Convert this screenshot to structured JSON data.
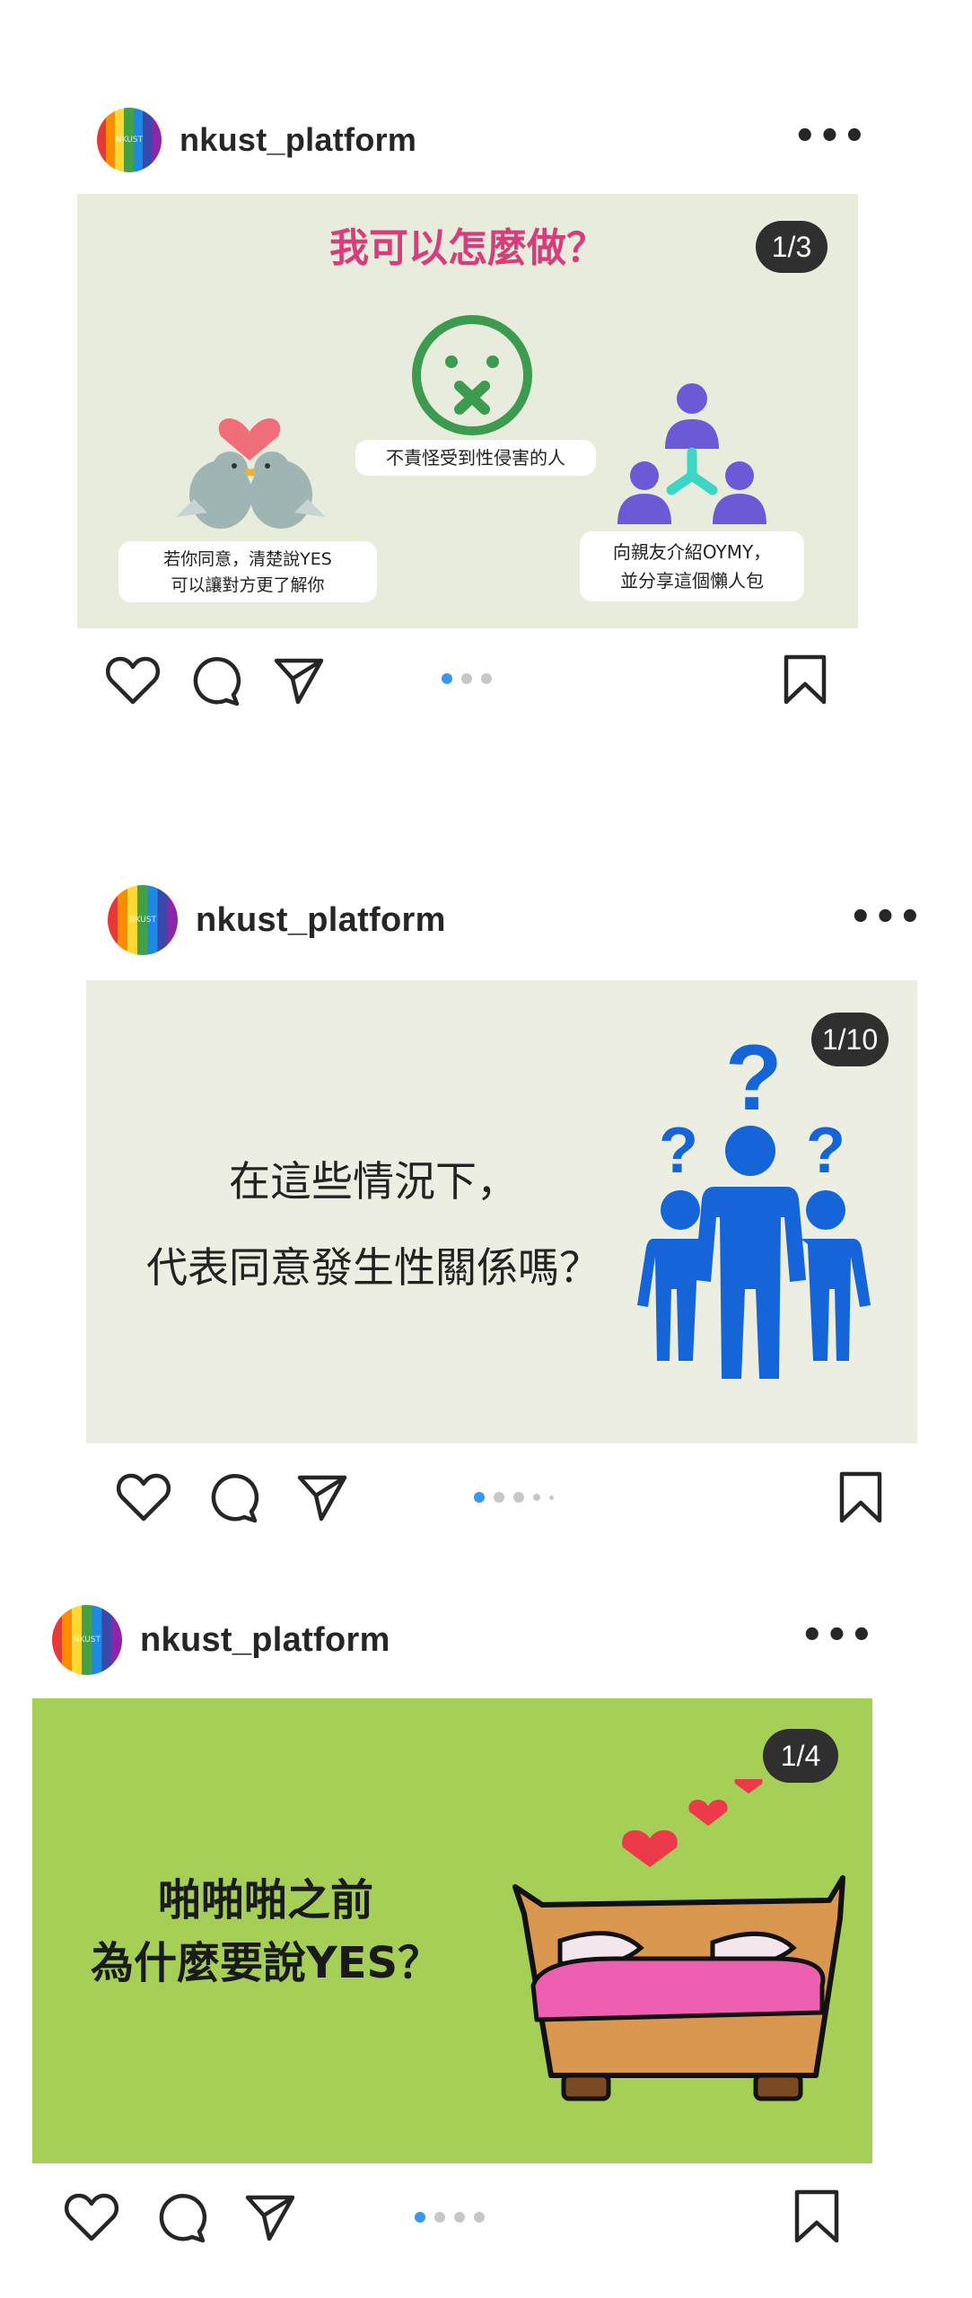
{
  "posts": [
    {
      "username": "nkust_platform",
      "avatar_text": "NKUST",
      "more": "•••",
      "badge": "1/3",
      "slide": {
        "title": "我可以怎麼做？",
        "center_label": "不責怪受到性侵害的人",
        "left_label_1": "若你同意，清楚說YES",
        "left_label_2": "可以讓對方更了解你",
        "right_label_1": "向親友介紹OYMY，",
        "right_label_2": "並分享這個懶人包"
      },
      "dots": 3
    },
    {
      "username": "nkust_platform",
      "avatar_text": "NKUST",
      "more": "•••",
      "badge": "1/10",
      "slide": {
        "line1": "在這些情況下，",
        "line2": "代表同意發生性關係嗎？"
      },
      "dots": 5
    },
    {
      "username": "nkust_platform",
      "avatar_text": "NKUST",
      "more": "•••",
      "badge": "1/4",
      "slide": {
        "line1": "啪啪啪之前",
        "line2": "為什麼要說YES？"
      },
      "dots": 4
    }
  ],
  "icons": {
    "like": "heart-icon",
    "comment": "comment-icon",
    "share": "paper-plane-icon",
    "save": "bookmark-icon"
  },
  "colors": {
    "slide1_bg": "#e8ecdc",
    "slide2_bg": "#eceee2",
    "slide3_bg": "#a6cf58",
    "title_pink": "#d63d7a",
    "dot_active": "#3897f0",
    "figure_blue": "#1565d8"
  }
}
